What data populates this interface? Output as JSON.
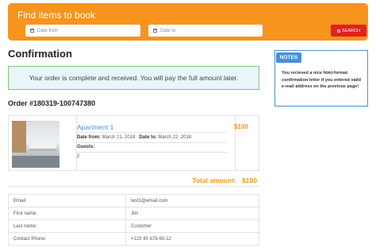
{
  "search": {
    "title": "Find items to book",
    "date_from_placeholder": "Date from",
    "date_to_placeholder": "Date to",
    "button_label": "SEARCH",
    "accent_color": "#f7941d",
    "button_color": "#e2211c"
  },
  "page": {
    "title": "Confirmation"
  },
  "notice": {
    "text": "Your order is complete and received. You will pay the full amount later."
  },
  "notes": {
    "tab_label": "NOTES",
    "text": "You recieved a nice html-format confirmation letter if you entered valid e-mail address on the previous page!"
  },
  "order": {
    "number": "Order #180319-100747380",
    "item": {
      "name": "Apartment 1",
      "price": "$100",
      "date_from_label": "Date from:",
      "date_from": "March 21, 2018",
      "date_to_label": "Date to:",
      "date_to": "March 22, 2018",
      "guests_label": "Guests:",
      "guests": "2"
    },
    "total_label": "Total amount:",
    "total_value": "$100"
  },
  "customer": [
    {
      "label": "Email:",
      "value": "test1@email.com"
    },
    {
      "label": "First name:",
      "value": "Jim"
    },
    {
      "label": "Last name:",
      "value": "Customer"
    },
    {
      "label": "Contact Phone:",
      "value": "+123 45 678-90-12"
    }
  ]
}
